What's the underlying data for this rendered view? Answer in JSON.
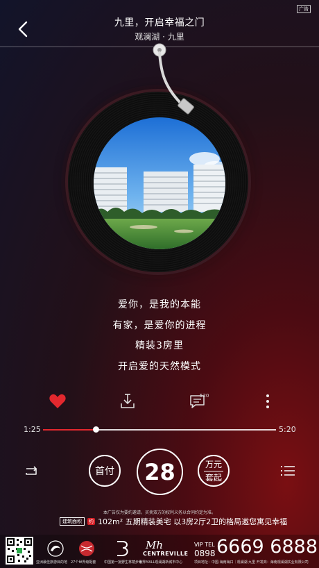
{
  "ad_tag": "广告",
  "header": {
    "title": "九里，开启幸福之门",
    "subtitle": "观澜湖 · 九里"
  },
  "lyrics": [
    "爱你，是我的本能",
    "有家，是爱你的进程",
    "精装3房里",
    "开启爱的天然模式"
  ],
  "actions": {
    "comment_count": "520",
    "like_color": "#e3282e"
  },
  "player": {
    "current_time": "1:25",
    "total_time": "5:20",
    "progress_fraction": 0.226
  },
  "controls": {
    "down_payment_label": "首付",
    "amount": "28",
    "unit_top": "万元",
    "unit_bottom": "套起"
  },
  "disclaimer": "本广告仅为要约邀请，买卖双方的权利义务以合同约定为准。",
  "promo": {
    "tag": "建筑面积",
    "badge": "约",
    "text": "102m² 五期精装美宅 以3房2厅2卫的格局邀您寓见幸福"
  },
  "footer": {
    "logo_captions": [
      "亚洲最佳旅游目的地",
      "27个世界级配套",
      "中国第一批野生林荫步道",
      "世界MALL观澜湖新城市中心"
    ],
    "brand_line1": "Mh",
    "brand_line2": "CENTREVILLE",
    "vip_label": "VIP TEL",
    "phone_prefix": "0898",
    "phone_number": "6669 6888",
    "note": "项目地址：中国·海南海口｜观澜湖·九里  开发商：海南观澜湖实业有限公司"
  }
}
